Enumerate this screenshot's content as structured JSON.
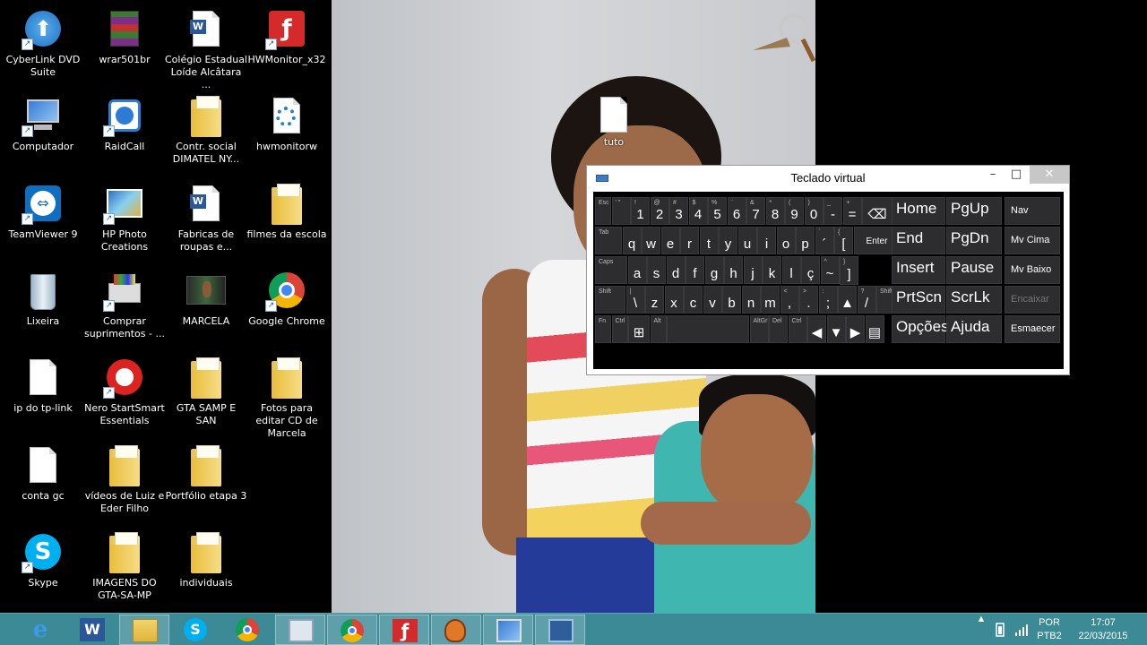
{
  "desktop": {
    "icons": [
      {
        "label": "CyberLink DVD Suite",
        "icon": "cyberlink-dvd-icon"
      },
      {
        "label": "Computador",
        "icon": "computer-icon"
      },
      {
        "label": "TeamViewer 9",
        "icon": "teamviewer-icon"
      },
      {
        "label": "Lixeira",
        "icon": "recycle-bin-icon"
      },
      {
        "label": "ip do tp-link",
        "icon": "text-document-icon"
      },
      {
        "label": "conta gc",
        "icon": "text-document-icon"
      },
      {
        "label": "Skype",
        "icon": "skype-icon"
      },
      {
        "label": "wrar501br",
        "icon": "winrar-icon"
      },
      {
        "label": "RaidCall",
        "icon": "raidcall-icon"
      },
      {
        "label": "HP Photo Creations",
        "icon": "hp-photo-icon"
      },
      {
        "label": "Comprar suprimentos - ...",
        "icon": "printer-icon"
      },
      {
        "label": "Nero StartSmart Essentials",
        "icon": "nero-icon"
      },
      {
        "label": "vídeos de Luiz e Eder Filho",
        "icon": "folder-icon"
      },
      {
        "label": "IMAGENS DO GTA-SA-MP",
        "icon": "folder-icon"
      },
      {
        "label": "Colégio Estadual Loíde Alcâtara ...",
        "icon": "word-document-icon"
      },
      {
        "label": "Contr. social DIMATEL NY...",
        "icon": "folder-icon"
      },
      {
        "label": "Fabricas de roupas e...",
        "icon": "word-document-icon"
      },
      {
        "label": "MARCELA",
        "icon": "video-file-icon"
      },
      {
        "label": "GTA SAMP E SAN",
        "icon": "folder-icon"
      },
      {
        "label": "Portfólio etapa 3",
        "icon": "folder-icon"
      },
      {
        "label": "individuais",
        "icon": "folder-icon"
      },
      {
        "label": "HWMonitor_x32",
        "icon": "flash-app-icon"
      },
      {
        "label": "hwmonitorw",
        "icon": "settings-file-icon"
      },
      {
        "label": "filmes da escola",
        "icon": "folder-icon"
      },
      {
        "label": "Google Chrome",
        "icon": "chrome-icon"
      },
      {
        "label": "Fotos para editar CD de Marcela",
        "icon": "folder-icon"
      }
    ],
    "wallpaper_file": {
      "label": "tuto",
      "icon": "text-document-icon"
    }
  },
  "osk": {
    "title": "Teclado virtual",
    "minimize": "–",
    "maximize": "□",
    "close": "✕",
    "rows": [
      [
        {
          "m": "",
          "s": "Esc"
        },
        {
          "m": "",
          "s": "'  \""
        },
        {
          "m": "1",
          "s": "!"
        },
        {
          "m": "2",
          "s": "@"
        },
        {
          "m": "3",
          "s": "#"
        },
        {
          "m": "4",
          "s": "$"
        },
        {
          "m": "5",
          "s": "%"
        },
        {
          "m": "6",
          "s": "¨"
        },
        {
          "m": "7",
          "s": "&"
        },
        {
          "m": "8",
          "s": "*"
        },
        {
          "m": "9",
          "s": "("
        },
        {
          "m": "0",
          "s": ")"
        },
        {
          "m": "-",
          "s": "_"
        },
        {
          "m": "=",
          "s": "+"
        },
        {
          "m": "⌫",
          "s": ""
        }
      ],
      [
        {
          "m": "",
          "s": "Tab"
        },
        {
          "m": "q",
          "s": ""
        },
        {
          "m": "w",
          "s": ""
        },
        {
          "m": "e",
          "s": ""
        },
        {
          "m": "r",
          "s": ""
        },
        {
          "m": "t",
          "s": ""
        },
        {
          "m": "y",
          "s": ""
        },
        {
          "m": "u",
          "s": ""
        },
        {
          "m": "i",
          "s": ""
        },
        {
          "m": "o",
          "s": ""
        },
        {
          "m": "p",
          "s": ""
        },
        {
          "m": "´",
          "s": "`"
        },
        {
          "m": "[",
          "s": "{"
        },
        {
          "m": "Enter",
          "s": ""
        }
      ],
      [
        {
          "m": "",
          "s": "Caps"
        },
        {
          "m": "a",
          "s": ""
        },
        {
          "m": "s",
          "s": ""
        },
        {
          "m": "d",
          "s": ""
        },
        {
          "m": "f",
          "s": ""
        },
        {
          "m": "g",
          "s": ""
        },
        {
          "m": "h",
          "s": ""
        },
        {
          "m": "j",
          "s": ""
        },
        {
          "m": "k",
          "s": ""
        },
        {
          "m": "l",
          "s": ""
        },
        {
          "m": "ç",
          "s": ""
        },
        {
          "m": "~",
          "s": "^"
        },
        {
          "m": "]",
          "s": "}"
        }
      ],
      [
        {
          "m": "",
          "s": "Shift"
        },
        {
          "m": "\\",
          "s": "|"
        },
        {
          "m": "z",
          "s": ""
        },
        {
          "m": "x",
          "s": ""
        },
        {
          "m": "c",
          "s": ""
        },
        {
          "m": "v",
          "s": ""
        },
        {
          "m": "b",
          "s": ""
        },
        {
          "m": "n",
          "s": ""
        },
        {
          "m": "m",
          "s": ""
        },
        {
          "m": ",",
          "s": "<"
        },
        {
          "m": ".",
          "s": ">"
        },
        {
          "m": ";",
          "s": ":"
        },
        {
          "m": "▲",
          "s": ""
        },
        {
          "m": "/",
          "s": "?"
        },
        {
          "m": "",
          "s": "Shift"
        }
      ],
      [
        {
          "m": "",
          "s": "Fn"
        },
        {
          "m": "",
          "s": "Ctrl"
        },
        {
          "m": "⊞",
          "s": ""
        },
        {
          "m": "",
          "s": "Alt"
        },
        {
          "m": "",
          "s": ""
        },
        {
          "m": "",
          "s": "AltGr"
        },
        {
          "m": "",
          "s": "Del"
        },
        {
          "m": "",
          "s": "Ctrl"
        },
        {
          "m": "◀",
          "s": ""
        },
        {
          "m": "▼",
          "s": ""
        },
        {
          "m": "▶",
          "s": ""
        },
        {
          "m": "▤",
          "s": ""
        }
      ]
    ],
    "nav_keys": [
      [
        "Home",
        "PgUp",
        "Nav"
      ],
      [
        "End",
        "PgDn",
        "Mv Cima"
      ],
      [
        "Insert",
        "Pause",
        "Mv Baixo"
      ],
      [
        "PrtScn",
        "ScrLk",
        "Encaixar"
      ],
      [
        "Opções",
        "Ajuda",
        "Esmaecer"
      ]
    ]
  },
  "taskbar": {
    "apps": [
      {
        "name": "taskbar-internet-explorer",
        "icon": "internet-explorer-icon",
        "active": false
      },
      {
        "name": "taskbar-word",
        "icon": "word-icon",
        "active": false
      },
      {
        "name": "taskbar-file-explorer",
        "icon": "file-explorer-icon",
        "active": true
      },
      {
        "name": "taskbar-skype",
        "icon": "skype-icon",
        "active": false
      },
      {
        "name": "taskbar-chrome",
        "icon": "chrome-icon",
        "active": false
      },
      {
        "name": "taskbar-network",
        "icon": "network-computer-icon",
        "active": true
      },
      {
        "name": "taskbar-chrome-2",
        "icon": "chrome-icon",
        "active": true
      },
      {
        "name": "taskbar-flash",
        "icon": "flash-icon",
        "active": true
      },
      {
        "name": "taskbar-game",
        "icon": "glove-icon",
        "active": true
      },
      {
        "name": "taskbar-computer",
        "icon": "computer-icon",
        "active": true
      },
      {
        "name": "taskbar-onscreen-keyboard",
        "icon": "keyboard-icon",
        "active": true
      }
    ],
    "tray": {
      "language": "POR",
      "layout": "PTB2",
      "time": "17:07",
      "date": "22/03/2015"
    }
  },
  "colors": {
    "taskbar": "#3b8a96",
    "key": "#2d2d30",
    "osk_close": "#c7c7c7"
  }
}
